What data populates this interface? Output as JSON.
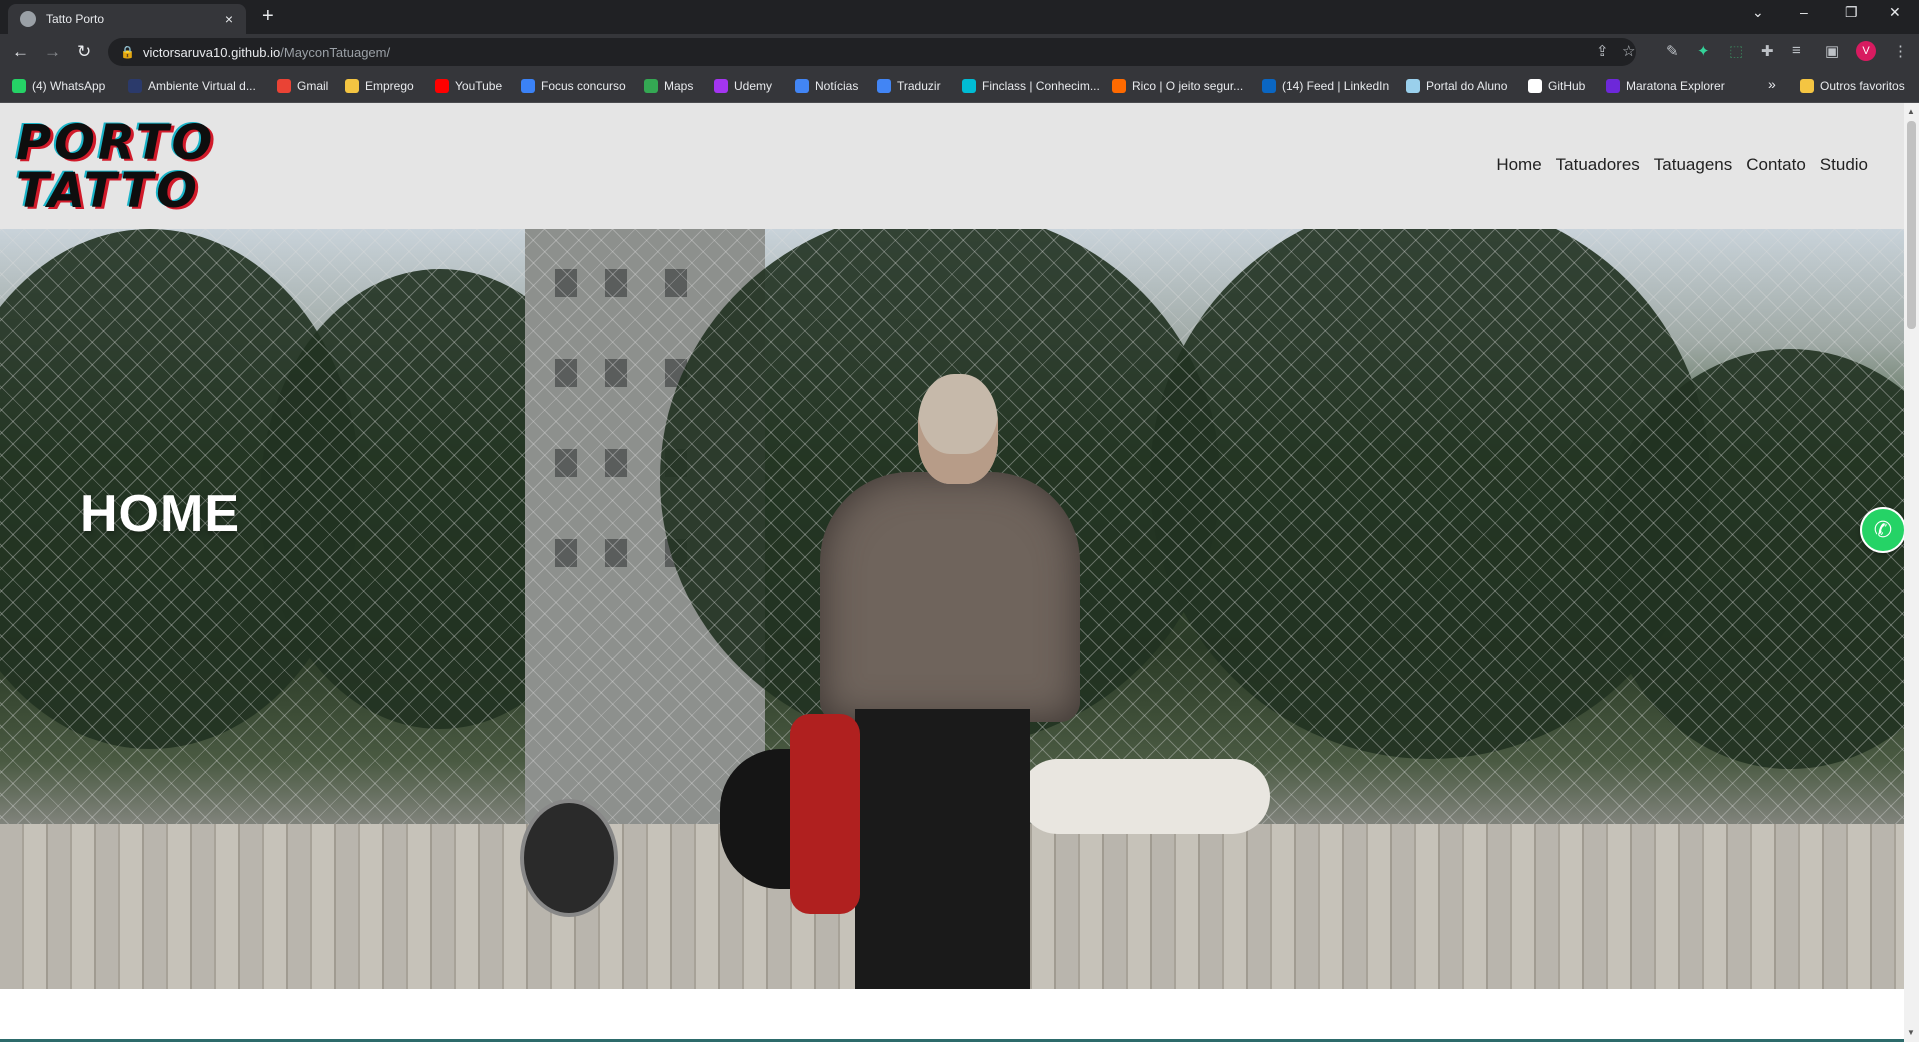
{
  "browser": {
    "tab_title": "Tatto Porto",
    "tab_close": "×",
    "new_tab": "+",
    "url_host": "victorsaruva10.github.io",
    "url_path": "/MayconTatuagem/",
    "avatar_initial": "V",
    "bookmarks": [
      {
        "label": "(4) WhatsApp",
        "color": "#25d366"
      },
      {
        "label": "Ambiente Virtual d...",
        "color": "#2b3a6b"
      },
      {
        "label": "Gmail",
        "color": "#ea4335"
      },
      {
        "label": "Emprego",
        "color": "#f4c542"
      },
      {
        "label": "YouTube",
        "color": "#ff0000"
      },
      {
        "label": "Focus concurso",
        "color": "#3b82f6"
      },
      {
        "label": "Maps",
        "color": "#34a853"
      },
      {
        "label": "Udemy",
        "color": "#a435f0"
      },
      {
        "label": "Notícias",
        "color": "#4285f4"
      },
      {
        "label": "Traduzir",
        "color": "#4285f4"
      },
      {
        "label": "Finclass | Conhecim...",
        "color": "#00bcd4"
      },
      {
        "label": "Rico | O jeito segur...",
        "color": "#ff6a00"
      },
      {
        "label": "(14) Feed | LinkedIn",
        "color": "#0a66c2"
      },
      {
        "label": "Portal do Aluno",
        "color": "#9ad0ec"
      },
      {
        "label": "GitHub",
        "color": "#ffffff"
      },
      {
        "label": "Maratona Explorer",
        "color": "#6d28d9"
      }
    ],
    "more_bookmarks": "»",
    "other_bookmarks": "Outros favoritos"
  },
  "site": {
    "logo_line1": "PORTO",
    "logo_line2": "TATTO",
    "nav": [
      "Home",
      "Tatuadores",
      "Tatuagens",
      "Contato",
      "Studio"
    ],
    "hero_title": "HOME"
  }
}
